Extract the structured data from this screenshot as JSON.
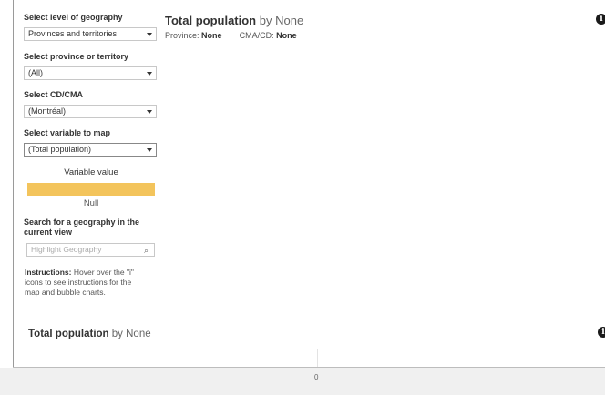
{
  "controls": {
    "geography": {
      "label": "Select level of geography",
      "value": "Provinces and territories"
    },
    "province": {
      "label": "Select province or territory",
      "value": "(All)"
    },
    "cdcma": {
      "label": "Select CD/CMA",
      "value": "(Montréal)"
    },
    "variable": {
      "label": "Select variable to map",
      "value": "(Total population)"
    }
  },
  "legend": {
    "title": "Variable value",
    "null_label": "Null",
    "color": "#f3c45c"
  },
  "search": {
    "label_line1": "Search for a geography in the",
    "label_line2": "current view",
    "placeholder": "Highlight Geography"
  },
  "instructions": {
    "heading": "Instructions:",
    "line1": " Hover over the \"i\"",
    "line2": "icons  to see instructions for the",
    "line3": "map and bubble charts."
  },
  "map_panel": {
    "title_main": "Total population",
    "title_by": " by None",
    "province_label": "Province:",
    "province_value": "None",
    "cmacd_label": "CMA/CD:",
    "cmacd_value": "None"
  },
  "bubble_panel": {
    "title_main": "Total population",
    "title_by": " by None",
    "axis_zero": "0"
  },
  "icons": {
    "info": "info-icon",
    "search": "search-icon",
    "dropdown": "chevron-down-icon"
  }
}
